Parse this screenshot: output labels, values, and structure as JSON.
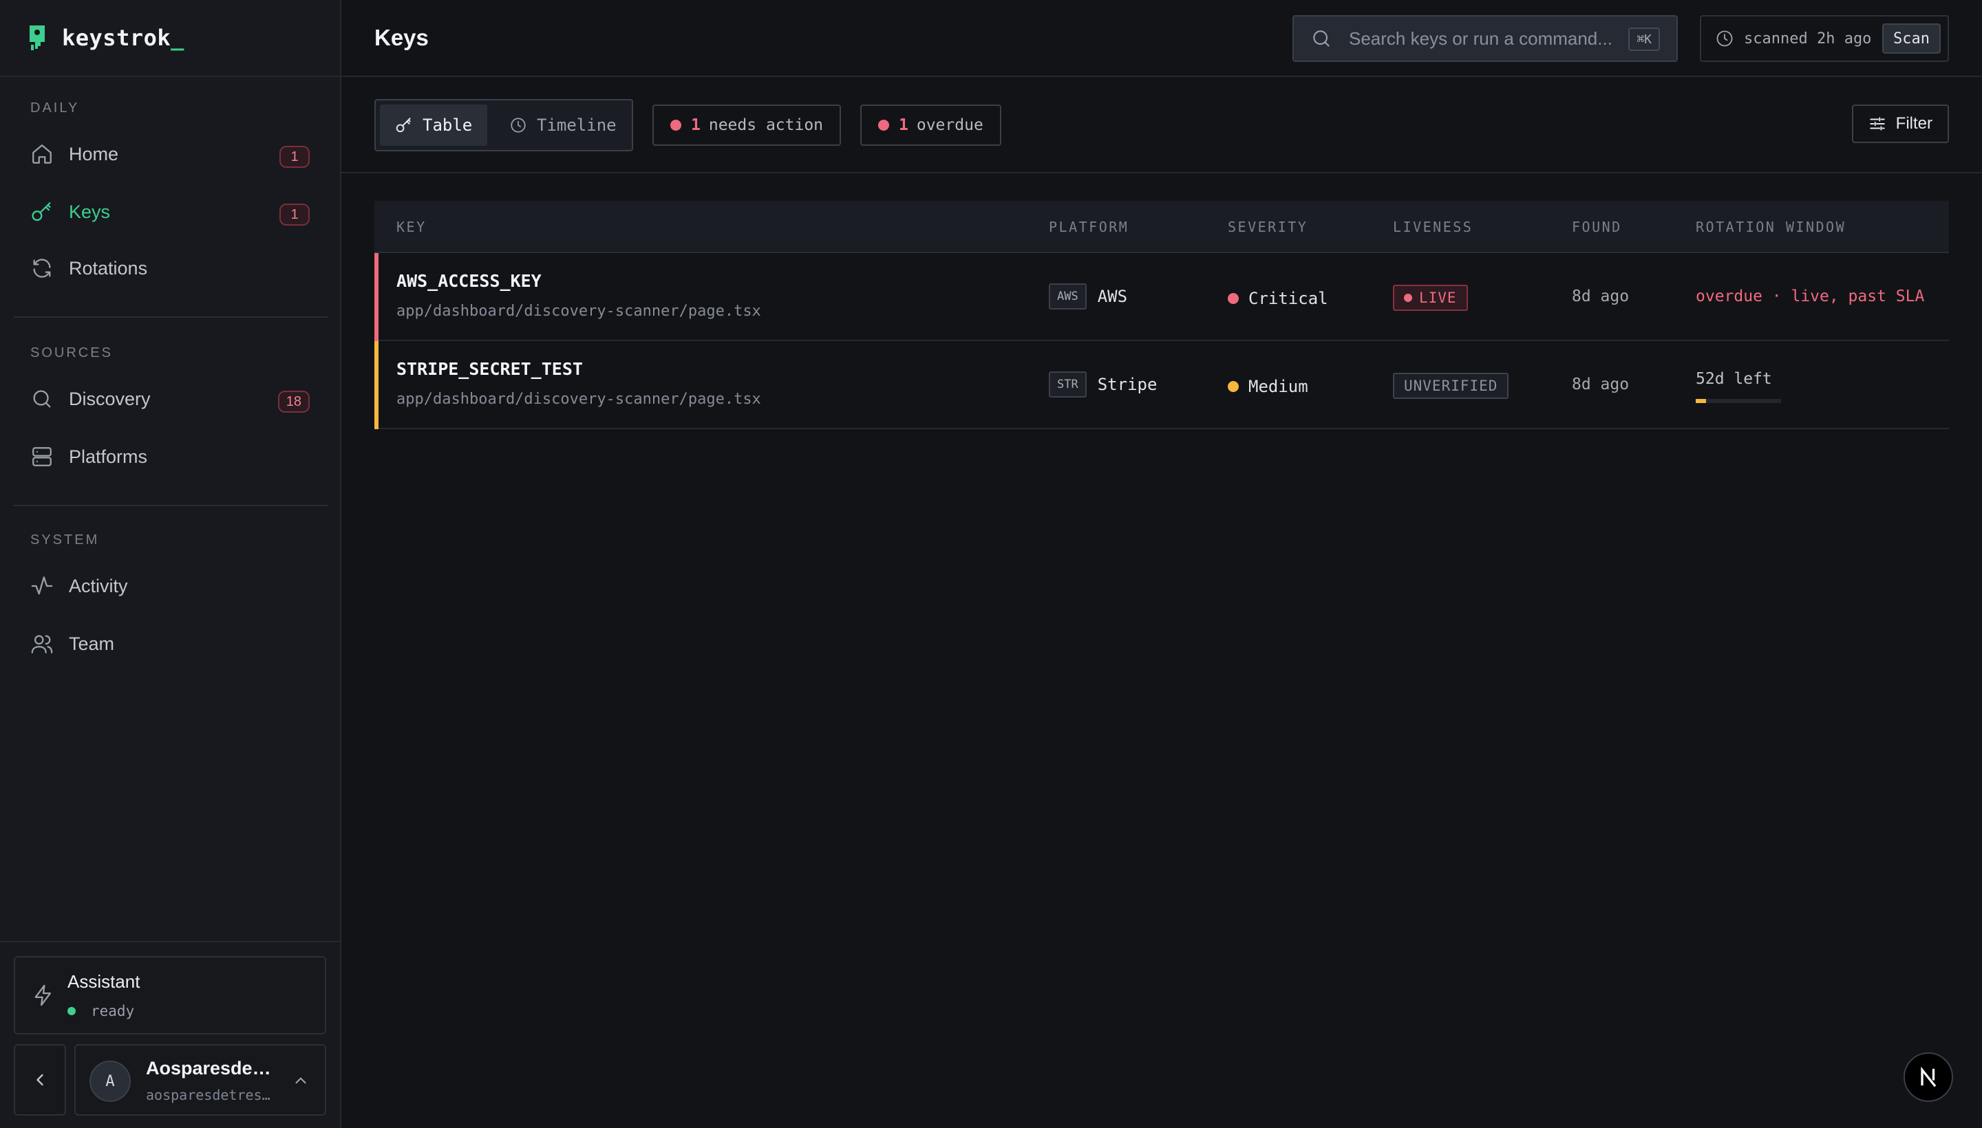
{
  "app": {
    "brand": "keystrok",
    "brand_cursor": "_"
  },
  "colors": {
    "accent": "#3ecf8e",
    "danger": "#f06a7f",
    "warning": "#f5b83d",
    "background": "#121317"
  },
  "sidebar": {
    "sections": [
      {
        "label": "DAILY",
        "items": [
          {
            "label": "Home",
            "icon": "home-icon",
            "badge": "1"
          },
          {
            "label": "Keys",
            "icon": "key-icon",
            "badge": "1",
            "active": true
          },
          {
            "label": "Rotations",
            "icon": "refresh-icon"
          }
        ]
      },
      {
        "label": "SOURCES",
        "items": [
          {
            "label": "Discovery",
            "icon": "search-icon",
            "badge": "18"
          },
          {
            "label": "Platforms",
            "icon": "server-icon"
          }
        ]
      },
      {
        "label": "SYSTEM",
        "items": [
          {
            "label": "Activity",
            "icon": "activity-icon"
          },
          {
            "label": "Team",
            "icon": "users-icon"
          }
        ]
      }
    ],
    "assistant": {
      "title": "Assistant",
      "status": "ready",
      "icon": "zap-icon"
    },
    "user": {
      "initial": "A",
      "name": "Aosparesdet…",
      "email": "aosparesdetres…"
    }
  },
  "header": {
    "title": "Keys",
    "search": {
      "placeholder": "Search keys or run a command...",
      "shortcut": "⌘K"
    },
    "scan_status": "scanned 2h ago",
    "scan_button": "Scan"
  },
  "toolbar": {
    "views": [
      {
        "label": "Table",
        "icon": "key-icon",
        "active": true
      },
      {
        "label": "Timeline",
        "icon": "clock-icon"
      }
    ],
    "chips": [
      {
        "count": "1",
        "label": "needs action"
      },
      {
        "count": "1",
        "label": "overdue"
      }
    ],
    "filter": "Filter"
  },
  "table": {
    "columns": [
      "KEY",
      "PLATFORM",
      "SEVERITY",
      "LIVENESS",
      "FOUND",
      "ROTATION WINDOW"
    ],
    "rows": [
      {
        "key": "AWS_ACCESS_KEY",
        "path": "app/dashboard/discovery-scanner/page.tsx",
        "platform_code": "AWS",
        "platform": "AWS",
        "severity": "Critical",
        "severity_color": "#f06a7f",
        "liveness": "LIVE",
        "found": "8d ago",
        "rotation": "overdue · live, past SLA"
      },
      {
        "key": "STRIPE_SECRET_TEST",
        "path": "app/dashboard/discovery-scanner/page.tsx",
        "platform_code": "STR",
        "platform": "Stripe",
        "severity": "Medium",
        "severity_color": "#f5b83d",
        "liveness": "UNVERIFIED",
        "found": "8d ago",
        "rotation": "52d left",
        "rotation_progress": 0.12
      }
    ]
  },
  "framework_badge": {
    "icon": "next-logo-icon"
  }
}
